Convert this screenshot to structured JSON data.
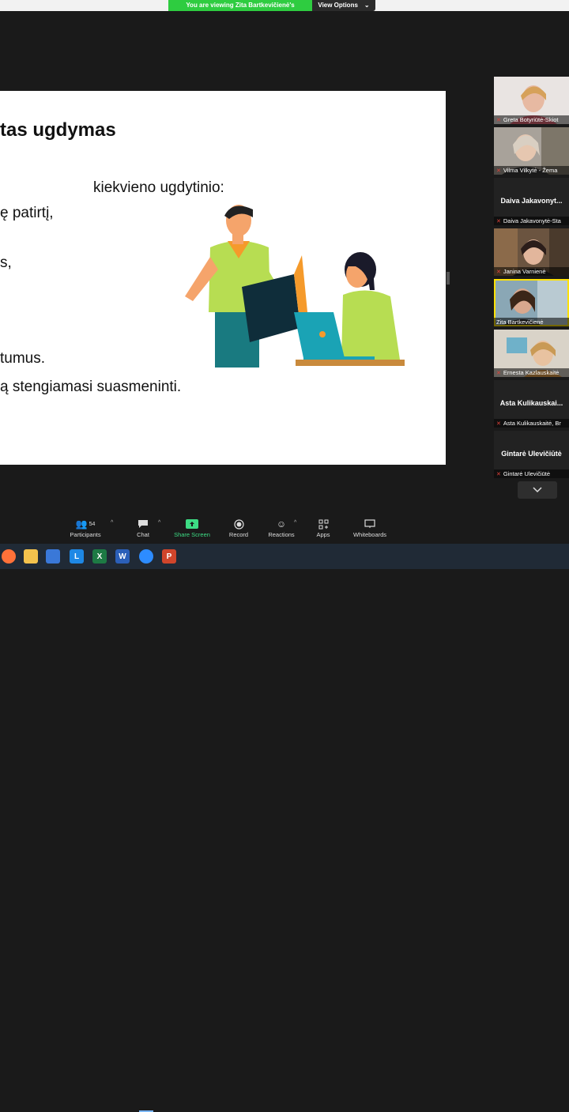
{
  "banner": {
    "viewing_text": "You are viewing Zita Bartkevičienė's screen",
    "view_options": "View Options"
  },
  "slide": {
    "title": "tas ugdymas",
    "lines": [
      "kiekvieno ugdytinio:",
      "ę patirtį,",
      "s,",
      "tumus.",
      "ą stengiamasi suasmeninti."
    ]
  },
  "gallery": [
    {
      "name": "Greta Botyriūtė-Skiot",
      "type": "video"
    },
    {
      "name": "Vilma Vilkytė - Žema",
      "type": "video"
    },
    {
      "name": "Daiva Jakavonytė-Sta",
      "big": "Daiva Jakavonyt...",
      "type": "name"
    },
    {
      "name": "Janina Varnienė",
      "type": "video"
    },
    {
      "name": "Zita Bartkevičienė",
      "type": "video",
      "active": true
    },
    {
      "name": "Ernesta Kazlauskaitė",
      "type": "video"
    },
    {
      "name": "Asta Kulikauskaitė, Br",
      "big": "Asta Kulikauskai...",
      "type": "name"
    },
    {
      "name": "Gintarė Ulevičiūtė",
      "big": "Gintarė Ulevičiūtė",
      "type": "name"
    }
  ],
  "toolbar": {
    "participants_label": "Participants",
    "participants_count": "54",
    "chat_label": "Chat",
    "share_label": "Share Screen",
    "record_label": "Record",
    "reactions_label": "Reactions",
    "apps_label": "Apps",
    "whiteboards_label": "Whiteboards"
  },
  "taskbar": {
    "icons": [
      "firefox-icon",
      "file-explorer-icon",
      "store-icon",
      "l-app-icon",
      "excel-icon",
      "word-icon",
      "zoom-icon",
      "powerpoint-icon"
    ]
  },
  "colors": {
    "share_green": "#3ddc84",
    "banner_green": "#2ecc40",
    "active_border": "#ffe100",
    "mic_muted": "#e0423a"
  }
}
